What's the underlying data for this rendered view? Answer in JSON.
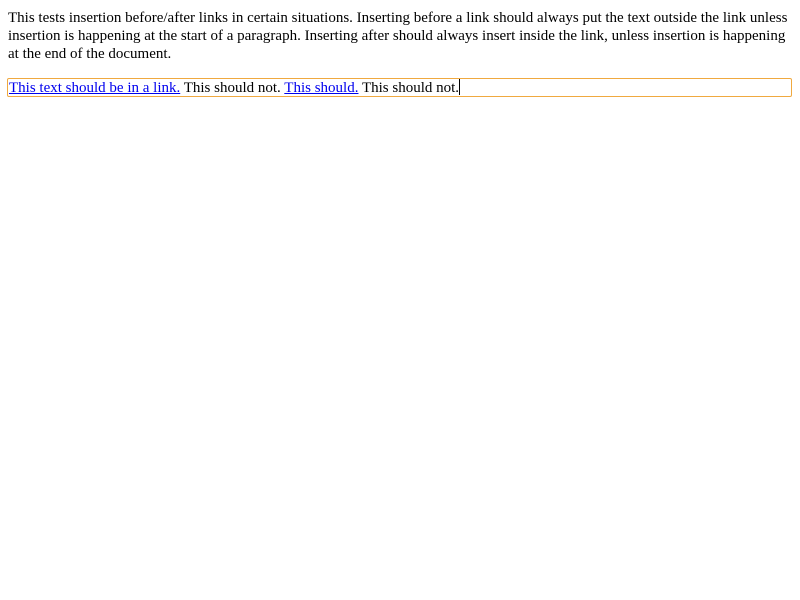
{
  "description": {
    "text": "This tests insertion before/after links in certain situations. Inserting before a link should always put the text outside the link unless insertion is happening at the start of a paragraph. Inserting after should always insert inside the link, unless insertion is happening at the end of the document."
  },
  "editor": {
    "link_1": "This text should be in a link.",
    "text_1": " This should not. ",
    "link_2": "This should.",
    "text_2": " This should not."
  },
  "colors": {
    "link": "#0000ee",
    "focus_border": "#f0a940",
    "text": "#000000",
    "background": "#ffffff"
  }
}
